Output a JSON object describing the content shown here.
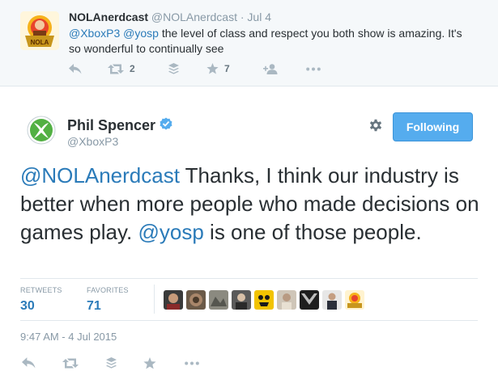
{
  "parent_tweet": {
    "avatar_icon": "nolanerdcast-logo-icon",
    "name": "NOLAnerdcast",
    "handle": "@NOLAnerdcast",
    "separator": "·",
    "date": "Jul 4",
    "mention1": "@XboxP3",
    "mention2": "@yosp",
    "text_rest": " the level of class and respect you both show is amazing. It's so wonderful to continually see",
    "actions": {
      "reply_icon": "reply-icon",
      "retweet_icon": "retweet-icon",
      "retweet_count": "2",
      "buffer_icon": "stack-icon",
      "favorite_icon": "star-icon",
      "favorite_count": "7",
      "follow_icon": "follow-user-icon",
      "more_icon": "more-dots-icon"
    }
  },
  "main_tweet": {
    "author_name": "Phil Spencer",
    "verified_icon": "verified-badge-icon",
    "handle": "@XboxP3",
    "avatar_icon": "xbox-logo-icon",
    "gear_icon": "gear-icon",
    "follow_label": "Following",
    "text_mention1": "@NOLAnerdcast",
    "text_part1": " Thanks, I think our industry is better when more people who made decisions on games play. ",
    "text_mention2": "@yosp",
    "text_part2": " is one of those people.",
    "stats": {
      "retweets_label": "RETWEETS",
      "retweets_value": "30",
      "favorites_label": "FAVORITES",
      "favorites_value": "71"
    },
    "favoriters": [
      "favoriter-avatar-1",
      "favoriter-avatar-2",
      "favoriter-avatar-3",
      "favoriter-avatar-4",
      "favoriter-avatar-5",
      "favoriter-avatar-6",
      "favoriter-avatar-7",
      "favoriter-avatar-8",
      "favoriter-avatar-9"
    ],
    "timestamp": "9:47 AM - 4 Jul 2015",
    "actions": [
      "reply-icon",
      "retweet-icon",
      "stack-icon",
      "star-icon",
      "more-dots-icon"
    ]
  },
  "colors": {
    "link_blue": "#2b7bb9",
    "button_blue": "#55acee",
    "muted_gray": "#8899a6",
    "parent_bg": "#f5f8fa",
    "xbox_green": "#52b043"
  }
}
